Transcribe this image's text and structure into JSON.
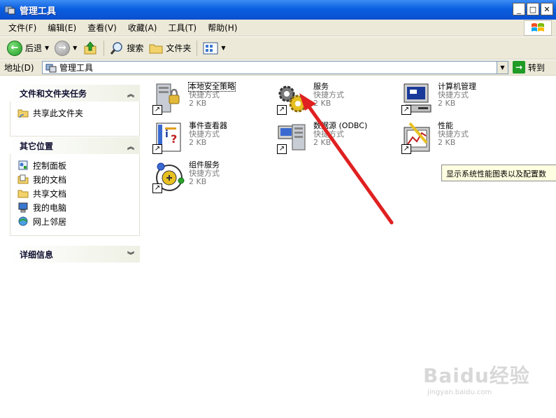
{
  "window": {
    "title": "管理工具"
  },
  "menu": [
    "文件(F)",
    "编辑(E)",
    "查看(V)",
    "收藏(A)",
    "工具(T)",
    "帮助(H)"
  ],
  "toolbar": {
    "back": "后退",
    "search": "搜索",
    "folders": "文件夹"
  },
  "address": {
    "label": "地址(D)",
    "value": "管理工具",
    "go": "转到"
  },
  "left_panel": {
    "file_tasks": {
      "title": "文件和文件夹任务",
      "items": [
        "共享此文件夹"
      ]
    },
    "other_places": {
      "title": "其它位置",
      "items": [
        "控制面板",
        "我的文档",
        "共享文档",
        "我的电脑",
        "网上邻居"
      ]
    },
    "details": {
      "title": "详细信息"
    }
  },
  "items": [
    {
      "name": "本地安全策略",
      "type": "快捷方式",
      "size": "2 KB"
    },
    {
      "name": "服务",
      "type": "快捷方式",
      "size": "2 KB"
    },
    {
      "name": "计算机管理",
      "type": "快捷方式",
      "size": "2 KB"
    },
    {
      "name": "事件查看器",
      "type": "快捷方式",
      "size": "2 KB"
    },
    {
      "name": "数据源 (ODBC)",
      "type": "快捷方式",
      "size": "2 KB"
    },
    {
      "name": "性能",
      "type": "快捷方式",
      "size": "2 KB"
    },
    {
      "name": "组件服务",
      "type": "快捷方式",
      "size": "2 KB"
    }
  ],
  "tooltip": "显示系统性能图表以及配置数",
  "watermark": {
    "main": "Baidu经验",
    "sub": "jingyan.baidu.com"
  },
  "colors": {
    "titlebar": "#0a5fe0",
    "annotation_arrow": "#e02020",
    "panel_bg": "#ece9d8"
  }
}
